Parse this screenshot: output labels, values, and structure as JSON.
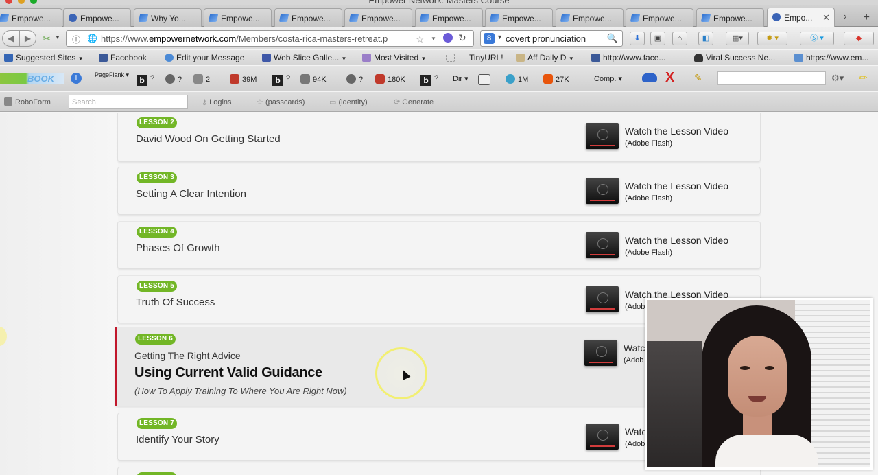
{
  "window": {
    "title": "Empower Network: Masters Course"
  },
  "tabs": [
    {
      "label": "Empowe...",
      "icon": "swirl"
    },
    {
      "label": "Empowe...",
      "icon": "globe"
    },
    {
      "label": "Why Yo...",
      "icon": "swirl"
    },
    {
      "label": "Empowe...",
      "icon": "swirl"
    },
    {
      "label": "Empowe...",
      "icon": "swirl"
    },
    {
      "label": "Empowe...",
      "icon": "swirl"
    },
    {
      "label": "Empowe...",
      "icon": "swirl"
    },
    {
      "label": "Empowe...",
      "icon": "swirl"
    },
    {
      "label": "Empowe...",
      "icon": "swirl"
    },
    {
      "label": "Empowe...",
      "icon": "swirl"
    },
    {
      "label": "Empowe...",
      "icon": "swirl"
    },
    {
      "label": "Empo...",
      "icon": "globe",
      "active": true
    }
  ],
  "nav": {
    "url_prefix": "https://www.",
    "url_domain": "empowernetwork.com",
    "url_rest": "/Members/costa-rica-masters-retreat.p",
    "search_value": "covert pronunciation"
  },
  "bookmarks": [
    "Suggested Sites",
    "Facebook",
    "Edit your Message",
    "Web Slice Galle...",
    "Most Visited",
    "",
    "TinyURL!",
    "Aff Daily D",
    "http://www.face...",
    "Viral Success Ne...",
    "https://www.em..."
  ],
  "addon": {
    "abook_label": "BOOK",
    "pageflank": "PageFlank",
    "stats": [
      "?",
      "?",
      "2",
      "39M",
      "?",
      "94K",
      "?",
      "180K",
      "?",
      "Dir",
      "1M",
      "27K"
    ],
    "comp": "Comp."
  },
  "roboform": {
    "label": "RoboForm",
    "search_placeholder": "Search",
    "logins": "Logins",
    "passcards": "(passcards)",
    "identity": "(identity)",
    "generate": "Generate"
  },
  "lessons": [
    {
      "badge": "LESSON 2",
      "title": "David Wood On Getting Started",
      "watch": "Watch the Lesson Video",
      "format": "(Adobe Flash)"
    },
    {
      "badge": "LESSON 3",
      "title": "Setting A Clear Intention",
      "watch": "Watch the Lesson Video",
      "format": "(Adobe Flash)"
    },
    {
      "badge": "LESSON 4",
      "title": "Phases Of Growth",
      "watch": "Watch the Lesson Video",
      "format": "(Adobe Flash)"
    },
    {
      "badge": "LESSON 5",
      "title": "Truth Of Success",
      "watch": "Watch the Lesson Video",
      "format": "(Adobe"
    },
    {
      "badge": "LESSON 6",
      "title": "Getting The Right Advice",
      "subtitle": "Using Current Valid Guidance",
      "note": "(How To Apply Training To Where You Are Right Now)",
      "watch": "Watc",
      "format": "(Adob"
    },
    {
      "badge": "LESSON 7",
      "title": "Identify Your Story",
      "watch": "Watc",
      "format": "(Adob"
    }
  ],
  "colors": {
    "badge": "#72b626",
    "current_marker": "#c1172b"
  }
}
